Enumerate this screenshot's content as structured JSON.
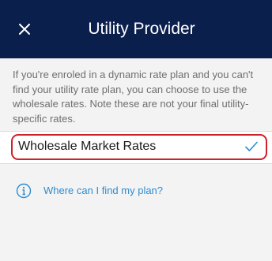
{
  "header": {
    "title": "Utility Provider",
    "close_icon": "close-icon"
  },
  "description": "If you're enroled in a dynamic rate plan and you can't find your utility rate plan, you can choose to use the wholesale rates. Note these are not your final utility-specific rates.",
  "option": {
    "label": "Wholesale Market Rates",
    "selected": true,
    "icon": "checkmark-icon"
  },
  "help": {
    "label": "Where can I find my plan?",
    "icon": "info-icon"
  },
  "colors": {
    "header_bg": "#0b1f4d",
    "accent": "#2e8ccf",
    "highlight": "#d0202a",
    "background": "#f3f3f3"
  }
}
